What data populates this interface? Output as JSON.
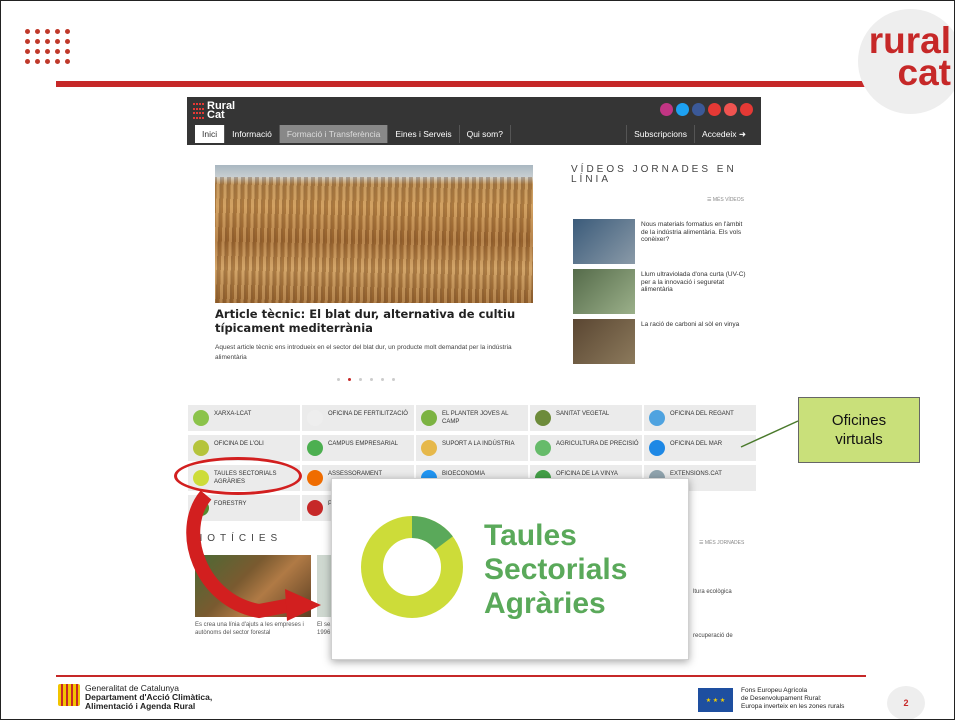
{
  "brand": {
    "logo_line1": "rural",
    "logo_line2": "cat"
  },
  "site": {
    "logo": "Rural Cat",
    "nav": [
      {
        "label": "Inici",
        "state": "active"
      },
      {
        "label": "Informació",
        "state": "normal"
      },
      {
        "label": "Formació i Transferència",
        "state": "highlight"
      },
      {
        "label": "Eines i Serveis",
        "state": "normal"
      },
      {
        "label": "Qui som?",
        "state": "normal"
      }
    ],
    "nav_right": [
      "Subscripcions",
      "Accedeix ➜"
    ],
    "social_icons": [
      "instagram-icon",
      "twitter-icon",
      "facebook-icon",
      "youtube-icon",
      "email-icon",
      "cloud-icon"
    ],
    "article": {
      "title": "Article tècnic: El blat dur, alternativa de cultiu típicament mediterrània",
      "description": "Aquest article tècnic ens introdueix en el sector del blat dur, un producte molt demandat per la indústria alimentària"
    },
    "videos": {
      "title": "VÍDEOS JORNADES EN LÍNIA",
      "more": "☰ MÉS VÍDEOS",
      "items": [
        "Nous materials formatius en l'àmbit de la indústria alimentària. Els vols conèixer?",
        "Llum ultraviolada d'ona curta (UV-C) per a la innovació i seguretat alimentària",
        "La ració de carboni al sòl en vinya"
      ]
    },
    "offices": [
      {
        "label": "XARXA-LCAT",
        "color": "#8bc34a"
      },
      {
        "label": "OFICINA DE FERTILITZACIÓ",
        "color": "#eeeeee"
      },
      {
        "label": "EL PLANTER JOVES AL CAMP",
        "color": "#7cb342"
      },
      {
        "label": "SANITAT VEGETAL",
        "color": "#6d8b3a"
      },
      {
        "label": "OFICINA DEL REGANT",
        "color": "#4fa3e0"
      },
      {
        "label": "OFICINA DE L'OLI",
        "color": "#b5c43c"
      },
      {
        "label": "CAMPUS EMPRESARIAL",
        "color": "#4caf50"
      },
      {
        "label": "SUPORT A LA INDÚSTRIA",
        "color": "#e6b84a"
      },
      {
        "label": "AGRICULTURA DE PRECISIÓ",
        "color": "#66bb6a"
      },
      {
        "label": "OFICINA DEL MAR",
        "color": "#1e88e5"
      },
      {
        "label": "TAULES SECTORIALS AGRÀRIES",
        "color": "#cddc39"
      },
      {
        "label": "ASSESSORAMENT",
        "color": "#ef6c00"
      },
      {
        "label": "BIOECONOMIA",
        "color": "#2196f3"
      },
      {
        "label": "OFICINA DE LA VINYA",
        "color": "#43a047"
      },
      {
        "label": "EXTENSIONS.CAT",
        "color": "#90a4ae"
      },
      {
        "label": "FORESTRY",
        "color": "#558b2f"
      },
      {
        "label": "P",
        "color": "#c62828"
      }
    ],
    "news": {
      "title": "NOTÍCIES",
      "more": "☰ MÉS JORNADES",
      "item1": "Es crea una línia d'ajuts a les empreses i autònoms del sector forestal",
      "item2": "El se... 1996",
      "side1": "ltura ecològica",
      "side2": "recuperació de"
    }
  },
  "callout": {
    "line1": "Oficines",
    "line2": "virtuals"
  },
  "popup": {
    "line1": "Taules",
    "line2": "Sectorials",
    "line3": "Agràries"
  },
  "footer": {
    "gen_line1": "Generalitat de Catalunya",
    "gen_line2": "Departament d'Acció Climàtica,",
    "gen_line3": "Alimentació i Agenda Rural",
    "eu_line1": "Fons Europeu Agrícola",
    "eu_line2": "de Desenvolupament Rural:",
    "eu_line3": "Europa inverteix en les zones rurals",
    "page": "2"
  }
}
